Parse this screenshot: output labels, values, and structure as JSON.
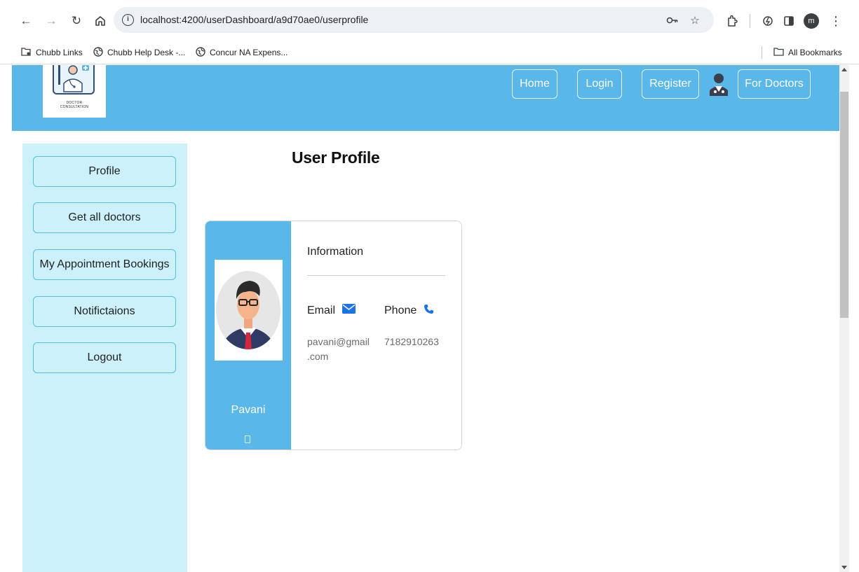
{
  "browser": {
    "url": "localhost:4200/userDashboard/a9d70ae0/userprofile",
    "profile_initial": "m",
    "bookmarks": [
      {
        "label": "Chubb Links",
        "icon": "folder-icon"
      },
      {
        "label": "Chubb Help Desk -...",
        "icon": "globe-icon"
      },
      {
        "label": "Concur NA Expens...",
        "icon": "globe-icon"
      }
    ],
    "all_bookmarks": "All Bookmarks"
  },
  "header": {
    "logo_caption_line1": "DOCTOR",
    "logo_caption_line2": "CONSULTATION",
    "nav": {
      "home": "Home",
      "login": "Login",
      "register": "Register",
      "for_doctors": "For Doctors"
    },
    "colors": {
      "bar": "#59b7ea"
    }
  },
  "sidebar": {
    "items": [
      {
        "label": "Profile"
      },
      {
        "label": "Get all doctors"
      },
      {
        "label": "My Appointment Bookings"
      },
      {
        "label": "Notifictaions"
      },
      {
        "label": "Logout"
      }
    ],
    "colors": {
      "background": "#cdf1fb",
      "border": "#4fc3dd"
    }
  },
  "main": {
    "title": "User Profile",
    "card": {
      "name": "Pavani",
      "info_title": "Information",
      "email_label": "Email",
      "email_value_line1": "pavani@gmail",
      "email_value_line2": ".com",
      "phone_label": "Phone",
      "phone_value": "7182910263",
      "icon_color": "#1a73e8"
    }
  }
}
